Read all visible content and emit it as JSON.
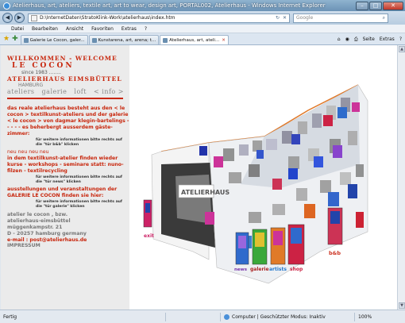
{
  "window": {
    "title": "Atelierhaus, art, ateliers, textile art, art to wear, design art, PORTAL002, Atelierhaus - Windows Internet Explorer"
  },
  "address": {
    "url": "D:\\InternetDaten\\StratoKlink-Work\\atelierhaus\\index.htm",
    "search_placeholder": "Google"
  },
  "menu": [
    "Datei",
    "Bearbeiten",
    "Ansicht",
    "Favoriten",
    "Extras",
    "?"
  ],
  "tabs": [
    {
      "label": "Galerie Le Cocon, galer...",
      "active": false
    },
    {
      "label": "Kunstarena, art, arena; t...",
      "active": false
    },
    {
      "label": "Atelierhaus, art, ateli...",
      "active": true
    }
  ],
  "tools": {
    "page": "Seite",
    "extras": "Extras"
  },
  "page": {
    "welcome": "WILLKOMMEN  -  WELCOME",
    "cocon": "LE COCON",
    "since": "since 1983 ........",
    "atelierhaus": "ATELIERHAUS   EIMSBÜTTEL",
    "hamburg": "HAMBURG",
    "nav_links": [
      "ateliers",
      "galerie",
      "loft",
      "< info >"
    ],
    "para1": "das reale atelierhaus besteht aus den < le cocon > textilkunst-ateliers und der galerie < le cocon > von dagmar klegin-bartelings - - - - - es beherbergt ausserdem gäste-zimmer:",
    "note1": "für weitere informationen bitte rechts auf die \"tür b&b\" klicken",
    "neu": "neu          neu          neu          neu",
    "para2": "in dem textilkunst-atelier finden wieder kurse - workshops - seminare statt:  nuno-filzen - textilrecycling",
    "note2": "für weitere informationen bitte rechts auf die \"tür news\" klicken",
    "para3": "ausstellungen und veranstaltungen der GALERIE LE COCON finden sie hier:",
    "note3": "für weitere informationen bitte rechts auf die \"tür galerie\" klicken",
    "address_lines": [
      "atelier le cocon  ,  bzw.",
      "atelierhaus-eimsbüttel",
      "müggenkampstr. 21",
      "D - 20257 hamburg      germany"
    ],
    "email": "e-mail : post@atelierhaus.de",
    "impressum": "IMPRESSUM"
  },
  "collage": {
    "door_labels": [
      "exit",
      "news",
      "galerie",
      "artists",
      "shop",
      "b&b"
    ],
    "sign": "ATELIERHAUS"
  },
  "status": {
    "left": "Fertig",
    "zone": "Computer | Geschützter Modus: Inaktiv",
    "zoom": "100%"
  },
  "colors": {
    "accent_red": "#c8260c",
    "window_blue": "#6b92b5"
  }
}
